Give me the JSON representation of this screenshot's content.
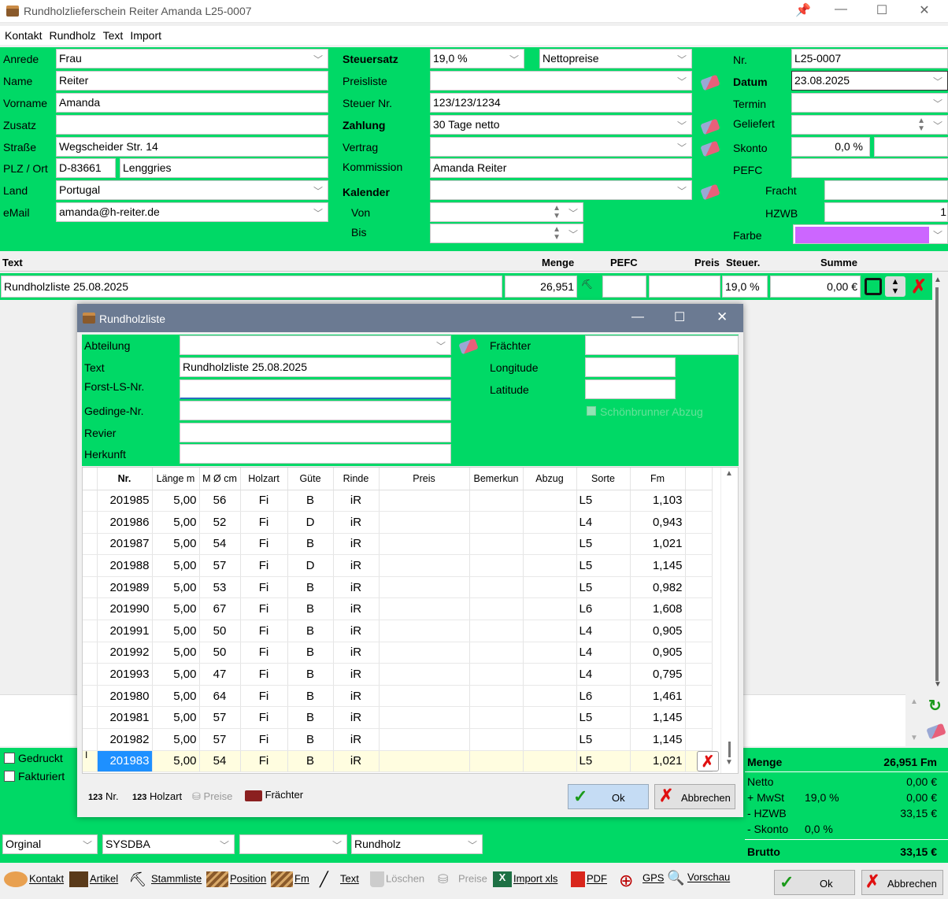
{
  "window": {
    "title": "Rundholzlieferschein Reiter Amanda L25-0007"
  },
  "menu": [
    "Kontakt",
    "Rundholz",
    "Text",
    "Import"
  ],
  "contact": {
    "anrede_label": "Anrede",
    "anrede": "Frau",
    "name_label": "Name",
    "name": "Reiter",
    "vorname_label": "Vorname",
    "vorname": "Amanda",
    "zusatz_label": "Zusatz",
    "zusatz": "",
    "strasse_label": "Straße",
    "strasse": "Wegscheider Str. 14",
    "plz_label": "PLZ / Ort",
    "plz": "D-83661",
    "ort": "Lenggries",
    "land_label": "Land",
    "land": "Portugal",
    "email_label": "eMail",
    "email": "amanda@h-reiter.de"
  },
  "middle": {
    "steuersatz_label": "Steuersatz",
    "steuersatz": "19,0 %",
    "preismodus": "Nettopreise",
    "preisliste_label": "Preisliste",
    "preisliste": "",
    "steuernr_label": "Steuer Nr.",
    "steuernr": "123/123/1234",
    "zahlung_label": "Zahlung",
    "zahlung": "30 Tage netto",
    "vertrag_label": "Vertrag",
    "vertrag": "",
    "kommission_label": "Kommission",
    "kommission": "Amanda Reiter",
    "kalender_label": "Kalender",
    "kalender": "",
    "von_label": "Von",
    "bis_label": "Bis"
  },
  "right": {
    "nr_label": "Nr.",
    "nr": "L25-0007",
    "datum_label": "Datum",
    "datum": "23.08.2025",
    "termin_label": "Termin",
    "geliefert_label": "Geliefert",
    "skonto_label": "Skonto",
    "skonto": "0,0 %",
    "pefc_label": "PEFC",
    "fracht_label": "Fracht",
    "hzwb_label": "HZWB",
    "hzwb_value": "1",
    "farbe_label": "Farbe",
    "farbe_color": "#cc66ff"
  },
  "positions": {
    "headers": {
      "text": "Text",
      "menge": "Menge",
      "pefc": "PEFC",
      "preis": "Preis",
      "steuer": "Steuer.",
      "summe": "Summe"
    },
    "row": {
      "text": "Rundholzliste 25.08.2025",
      "menge": "26,951",
      "steuer": "19,0 %",
      "summe": "0,00 €"
    }
  },
  "dialog": {
    "title": "Rundholzliste",
    "abteilung_label": "Abteilung",
    "abteilung": "",
    "text_label": "Text",
    "text": "Rundholzliste 25.08.2025",
    "forst_label": "Forst-LS-Nr.",
    "gedinge_label": "Gedinge-Nr.",
    "revier_label": "Revier",
    "herkunft_label": "Herkunft",
    "fraechter_label": "Frächter",
    "longitude_label": "Longitude",
    "latitude_label": "Latitude",
    "schoenbrunner_label": "Schönbrunner Abzug",
    "columns": [
      "Nr.",
      "Länge m",
      "M Ø cm",
      "Holzart",
      "Güte",
      "Rinde",
      "Preis",
      "Bemerkun",
      "Abzug",
      "Sorte",
      "Fm"
    ],
    "rows": [
      [
        "201985",
        "5,00",
        "56",
        "Fi",
        "B",
        "iR",
        "",
        "",
        "",
        "L5",
        "1,103"
      ],
      [
        "201986",
        "5,00",
        "52",
        "Fi",
        "D",
        "iR",
        "",
        "",
        "",
        "L4",
        "0,943"
      ],
      [
        "201987",
        "5,00",
        "54",
        "Fi",
        "B",
        "iR",
        "",
        "",
        "",
        "L5",
        "1,021"
      ],
      [
        "201988",
        "5,00",
        "57",
        "Fi",
        "D",
        "iR",
        "",
        "",
        "",
        "L5",
        "1,145"
      ],
      [
        "201989",
        "5,00",
        "53",
        "Fi",
        "B",
        "iR",
        "",
        "",
        "",
        "L5",
        "0,982"
      ],
      [
        "201990",
        "5,00",
        "67",
        "Fi",
        "B",
        "iR",
        "",
        "",
        "",
        "L6",
        "1,608"
      ],
      [
        "201991",
        "5,00",
        "50",
        "Fi",
        "B",
        "iR",
        "",
        "",
        "",
        "L4",
        "0,905"
      ],
      [
        "201992",
        "5,00",
        "50",
        "Fi",
        "B",
        "iR",
        "",
        "",
        "",
        "L4",
        "0,905"
      ],
      [
        "201993",
        "5,00",
        "47",
        "Fi",
        "B",
        "iR",
        "",
        "",
        "",
        "L4",
        "0,795"
      ],
      [
        "201980",
        "5,00",
        "64",
        "Fi",
        "B",
        "iR",
        "",
        "",
        "",
        "L6",
        "1,461"
      ],
      [
        "201981",
        "5,00",
        "57",
        "Fi",
        "B",
        "iR",
        "",
        "",
        "",
        "L5",
        "1,145"
      ],
      [
        "201982",
        "5,00",
        "57",
        "Fi",
        "B",
        "iR",
        "",
        "",
        "",
        "L5",
        "1,145"
      ],
      [
        "201983",
        "5,00",
        "54",
        "Fi",
        "B",
        "iR",
        "",
        "",
        "",
        "L5",
        "1,021"
      ]
    ],
    "footer": {
      "sort_nr": "Nr.",
      "sort_holzart": "Holzart",
      "preise": "Preise",
      "fraechter": "Frächter",
      "sort_prefix": "123",
      "ok": "Ok",
      "abbrechen": "Abbrechen"
    }
  },
  "left_checks": {
    "gedruckt": "Gedruckt",
    "fakturiert": "Fakturiert"
  },
  "summary": {
    "menge_label": "Menge",
    "menge": "26,951 Fm",
    "netto_label": "Netto",
    "netto": "0,00 €",
    "mwst_label": "+ MwSt",
    "mwst_rate": "19,0 %",
    "mwst": "0,00 €",
    "hzwb_label": "- HZWB",
    "hzwb": "33,15 €",
    "skonto_label": "- Skonto",
    "skonto_rate": "0,0 %",
    "brutto_label": "Brutto",
    "brutto": "33,15 €"
  },
  "bottom_selects": {
    "s1": "Orginal",
    "s2": "SYSDBA",
    "s3": "",
    "s4": "Rundholz"
  },
  "toolbar": {
    "kontakt": "Kontakt",
    "artikel": "Artikel",
    "stammliste": "Stammliste",
    "position": "Position",
    "fm": "Fm",
    "text": "Text",
    "loeschen": "Löschen",
    "preise": "Preise",
    "import": "Import xls",
    "pdf": "PDF",
    "gps": "GPS",
    "vorschau": "Vorschau",
    "ok": "Ok",
    "abbrechen": "Abbrechen"
  },
  "icons": [
    "pin-icon",
    "minimize-icon",
    "maximize-icon",
    "close-icon",
    "eraser-icon",
    "chevron-down-icon",
    "refresh-icon",
    "checkmark-icon",
    "cross-icon"
  ]
}
